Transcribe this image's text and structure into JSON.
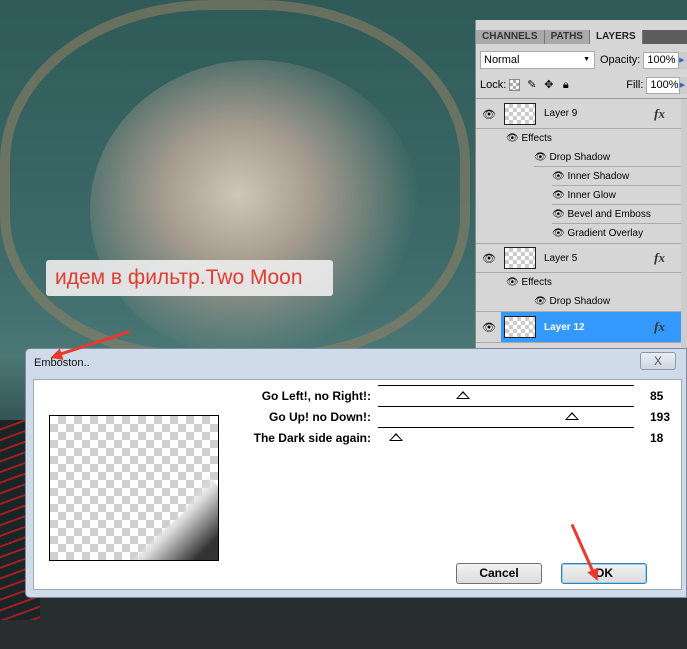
{
  "caption": "идем в фильтр.Two Moon",
  "panel": {
    "tabs": [
      "CHANNELS",
      "PATHS",
      "LAYERS"
    ],
    "active_tab": "LAYERS",
    "blend_mode": "Normal",
    "opacity_label": "Opacity:",
    "opacity": "100%",
    "lock_label": "Lock:",
    "fill_label": "Fill:",
    "fill": "100%",
    "layers": [
      {
        "name": "Layer 9",
        "fx": "fx",
        "effects_label": "Effects",
        "effects": [
          "Drop Shadow",
          "Inner Shadow",
          "Inner Glow",
          "Bevel and Emboss",
          "Gradient Overlay"
        ]
      },
      {
        "name": "Layer 5",
        "fx": "fx",
        "effects_label": "Effects",
        "effects": [
          "Drop Shadow"
        ]
      },
      {
        "name": "Layer 12",
        "fx": "fx",
        "selected": true
      }
    ],
    "selection_color": "#3399ff"
  },
  "dialog": {
    "title": "Emboston..",
    "close": "X",
    "sliders": [
      {
        "label": "Go Left!, no Right!:",
        "value": 85,
        "max": 255
      },
      {
        "label": "Go Up! no Down!:",
        "value": 193,
        "max": 255
      },
      {
        "label": "The Dark side again:",
        "value": 18,
        "max": 255
      }
    ],
    "cancel": "Cancel",
    "ok": "OK"
  }
}
